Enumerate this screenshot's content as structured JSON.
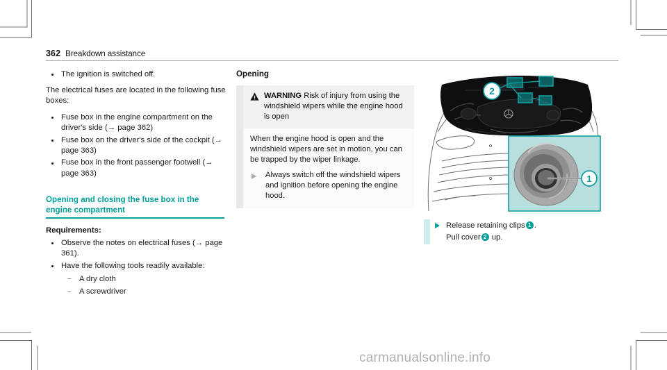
{
  "runhead": {
    "page_number": "362",
    "title": "Breakdown assistance"
  },
  "left_column": {
    "bullets_top": [
      "The ignition is switched off."
    ],
    "paragraph": "The electrical fuses are located in the following fuse boxes:",
    "bullets_fuseboxes": [
      "Fuse box in the engine compartment on the driver's side (→ page 362)",
      "Fuse box on the driver's side of the cockpit (→ page 363)",
      "Fuse box in the front passenger footwell (→ page 363)"
    ],
    "section_heading": "Opening and closing the fuse box in the engine compartment",
    "requirements_label": "Requirements:",
    "requirements": [
      "Observe the notes on electrical fuses (→ page 361).",
      "Have the following tools readily available:"
    ],
    "tools": [
      "A dry cloth",
      "A screwdriver"
    ]
  },
  "middle_column": {
    "heading": "Opening",
    "warning": {
      "icon": "warning-triangle-icon",
      "label": "WARNING",
      "title": "Risk of injury from using the windshield wipers while the engine hood is open",
      "body": "When the engine hood is open and the windshield wipers are set in motion, you can be trapped by the wiper linkage.",
      "action": "Always switch off the windshield wipers and ignition before opening the engine hood."
    }
  },
  "right_column": {
    "figure": {
      "name": "engine-compartment-illustration",
      "callout_2": "2",
      "inset_callout_1": "1"
    },
    "caption": {
      "line1_before": "Release retaining clips",
      "line1_marker": "1",
      "line1_after": ".",
      "line2_before": "Pull cover",
      "line2_marker": "2",
      "line2_after": "up."
    }
  },
  "watermark": "carmanualsonline.info",
  "colors": {
    "teal": "#00a19a",
    "teal_light": "#b8dede",
    "teal_pale": "#cfeced",
    "warn_header_bg": "#f2f2f2",
    "warn_body_bg": "#fafafa",
    "rule": "#a7a7a7"
  }
}
